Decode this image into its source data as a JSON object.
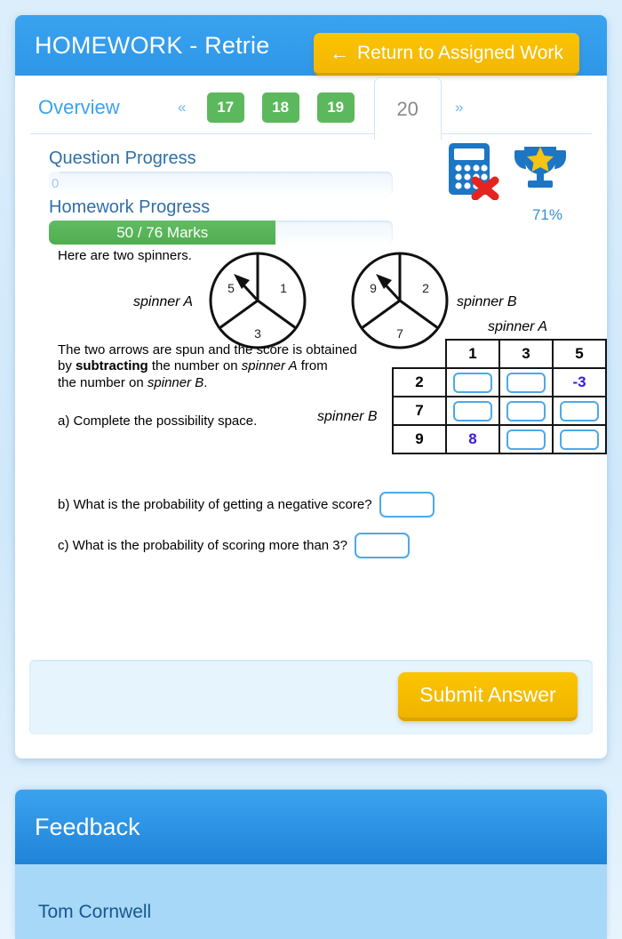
{
  "header": {
    "title": "HOMEWORK - Retrie",
    "return_button": "Return to Assigned Work",
    "back_arrow_icon": "←"
  },
  "tabs": {
    "overview_label": "Overview",
    "prev_label": "«",
    "next_label": "»",
    "items": [
      {
        "label": "17",
        "state": "complete"
      },
      {
        "label": "18",
        "state": "complete"
      },
      {
        "label": "19",
        "state": "complete"
      },
      {
        "label": "20",
        "state": "active"
      }
    ]
  },
  "progress": {
    "question_label": "Question Progress",
    "question_value": "0",
    "homework_label": "Homework Progress",
    "homework_value": "50 / 76 Marks",
    "homework_percent": 66,
    "score_percent": "71%",
    "calculator_icon": "no-calculator-icon",
    "trophy_icon": "trophy-icon"
  },
  "question": {
    "intro": "Here are two spinners.",
    "spinnerA_label": "spinner A",
    "spinnerB_label": "spinner B",
    "spinnerA_values": [
      "1",
      "3",
      "5"
    ],
    "spinnerB_values": [
      "2",
      "7",
      "9"
    ],
    "paragraph_1": "The two arrows are spun and the score is obtained",
    "paragraph_2_pre": "by ",
    "paragraph_2_bold": "subtracting",
    "paragraph_2_mid": " the number on ",
    "paragraph_2_ital": "spinner A",
    "paragraph_2_post": " from",
    "paragraph_3_pre": "the number on ",
    "paragraph_3_ital": "spinner B",
    "paragraph_3_post": ".",
    "part_a": "a) Complete the possibility space.",
    "part_b": "b) What is the probability of getting a negative score?",
    "part_c": "c) What is the probability of scoring more than 3?",
    "table": {
      "col_axis_label": "spinner A",
      "row_axis_label": "spinner B",
      "col_headers": [
        "1",
        "3",
        "5"
      ],
      "row_headers": [
        "2",
        "7",
        "9"
      ],
      "cells": [
        [
          "",
          "",
          "-3"
        ],
        [
          "",
          "",
          ""
        ],
        [
          "8",
          "",
          ""
        ]
      ]
    },
    "answer_b": "",
    "answer_c": ""
  },
  "submit": {
    "label": "Submit Answer"
  },
  "feedback": {
    "title": "Feedback",
    "author": "Tom Cornwell"
  }
}
